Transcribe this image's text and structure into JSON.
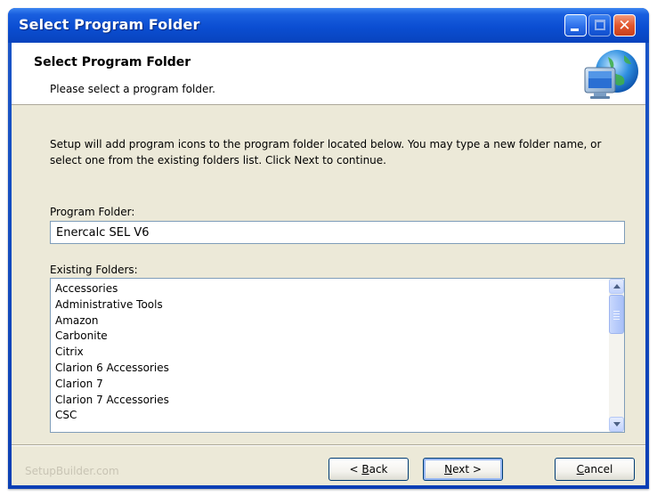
{
  "window": {
    "title": "Select Program Folder"
  },
  "header": {
    "title": "Select Program Folder",
    "subtitle": "Please select a program folder.",
    "icon": "computer-globe-icon"
  },
  "body": {
    "description": "Setup will add program icons to the program folder located below. You may type a new folder name, or select one from the existing folders list. Click Next to continue.",
    "program_folder_label": "Program Folder:",
    "program_folder_value": "Enercalc SEL V6",
    "existing_folders_label": "Existing Folders:",
    "existing_folders": [
      "Accessories",
      "Administrative Tools",
      "Amazon",
      "Carbonite",
      "Citrix",
      "Clarion 6 Accessories",
      "Clarion 7",
      "Clarion 7 Accessories",
      "CSC"
    ]
  },
  "footer": {
    "brand": "SetupBuilder.com",
    "back_prefix": "< ",
    "back_key": "B",
    "back_rest": "ack",
    "next_key": "N",
    "next_rest": "ext >",
    "cancel_key": "C",
    "cancel_rest": "ancel"
  },
  "colors": {
    "titlebar": "#0b4ed2",
    "dialog_face": "#ece9d8",
    "close_button": "#e2572e"
  }
}
